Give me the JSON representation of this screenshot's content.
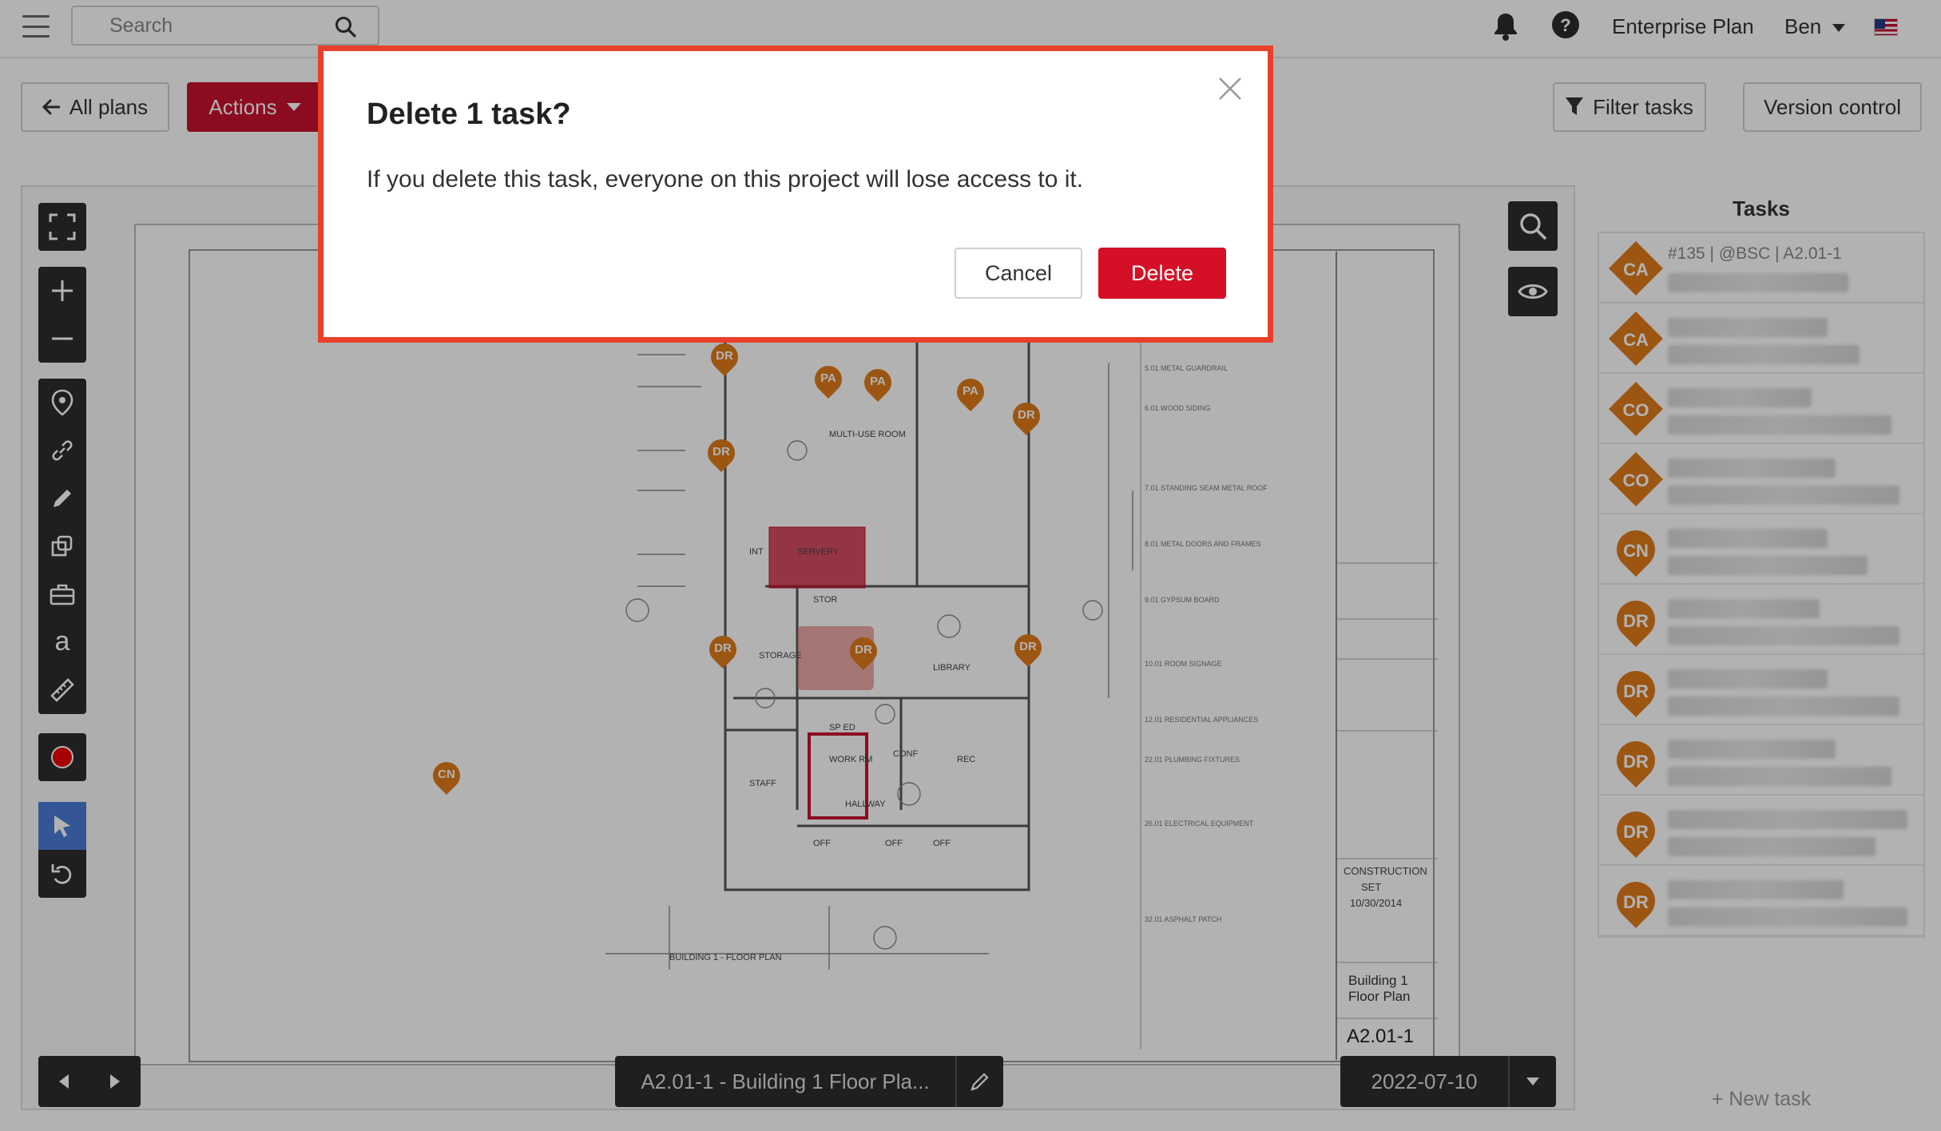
{
  "topbar": {
    "search_placeholder": "Search",
    "plan_label": "Enterprise Plan",
    "user_name": "Ben"
  },
  "toolbar": {
    "back_label": "All plans",
    "actions_label": "Actions",
    "filter_label": "Filter tasks",
    "version_label": "Version control"
  },
  "viewer": {
    "sheet_selector": "A2.01-1 - Building 1 Floor Pla...",
    "date_selector": "2022-07-10"
  },
  "drawing": {
    "pins": [
      {
        "label": "DR"
      },
      {
        "label": "PA"
      },
      {
        "label": "PA"
      },
      {
        "label": "PA"
      },
      {
        "label": "DR"
      },
      {
        "label": "DR"
      },
      {
        "label": "DR"
      },
      {
        "label": "DR"
      },
      {
        "label": "DR"
      },
      {
        "label": "CN"
      }
    ]
  },
  "tasks": {
    "title": "Tasks",
    "items": [
      {
        "badge": "CA",
        "shape": "diamond",
        "meta": "#135 | @BSC | A2.01-1"
      },
      {
        "badge": "CA",
        "shape": "diamond",
        "meta": ""
      },
      {
        "badge": "CO",
        "shape": "diamond",
        "meta": ""
      },
      {
        "badge": "CO",
        "shape": "diamond",
        "meta": ""
      },
      {
        "badge": "CN",
        "shape": "pin",
        "meta": ""
      },
      {
        "badge": "DR",
        "shape": "pin",
        "meta": ""
      },
      {
        "badge": "DR",
        "shape": "pin",
        "meta": ""
      },
      {
        "badge": "DR",
        "shape": "pin",
        "meta": ""
      },
      {
        "badge": "DR",
        "shape": "pin",
        "meta": ""
      },
      {
        "badge": "DR",
        "shape": "pin",
        "meta": ""
      }
    ],
    "new_task_label": "+ New task"
  },
  "colors": {
    "accent_red": "#c8102e",
    "delete_red": "#d50f25",
    "pin_orange": "#e07b1b",
    "modal_border": "#e8402a"
  },
  "modal": {
    "title": "Delete 1 task?",
    "body": "If you delete this task, everyone on this project will lose access to it.",
    "cancel_label": "Cancel",
    "delete_label": "Delete"
  }
}
